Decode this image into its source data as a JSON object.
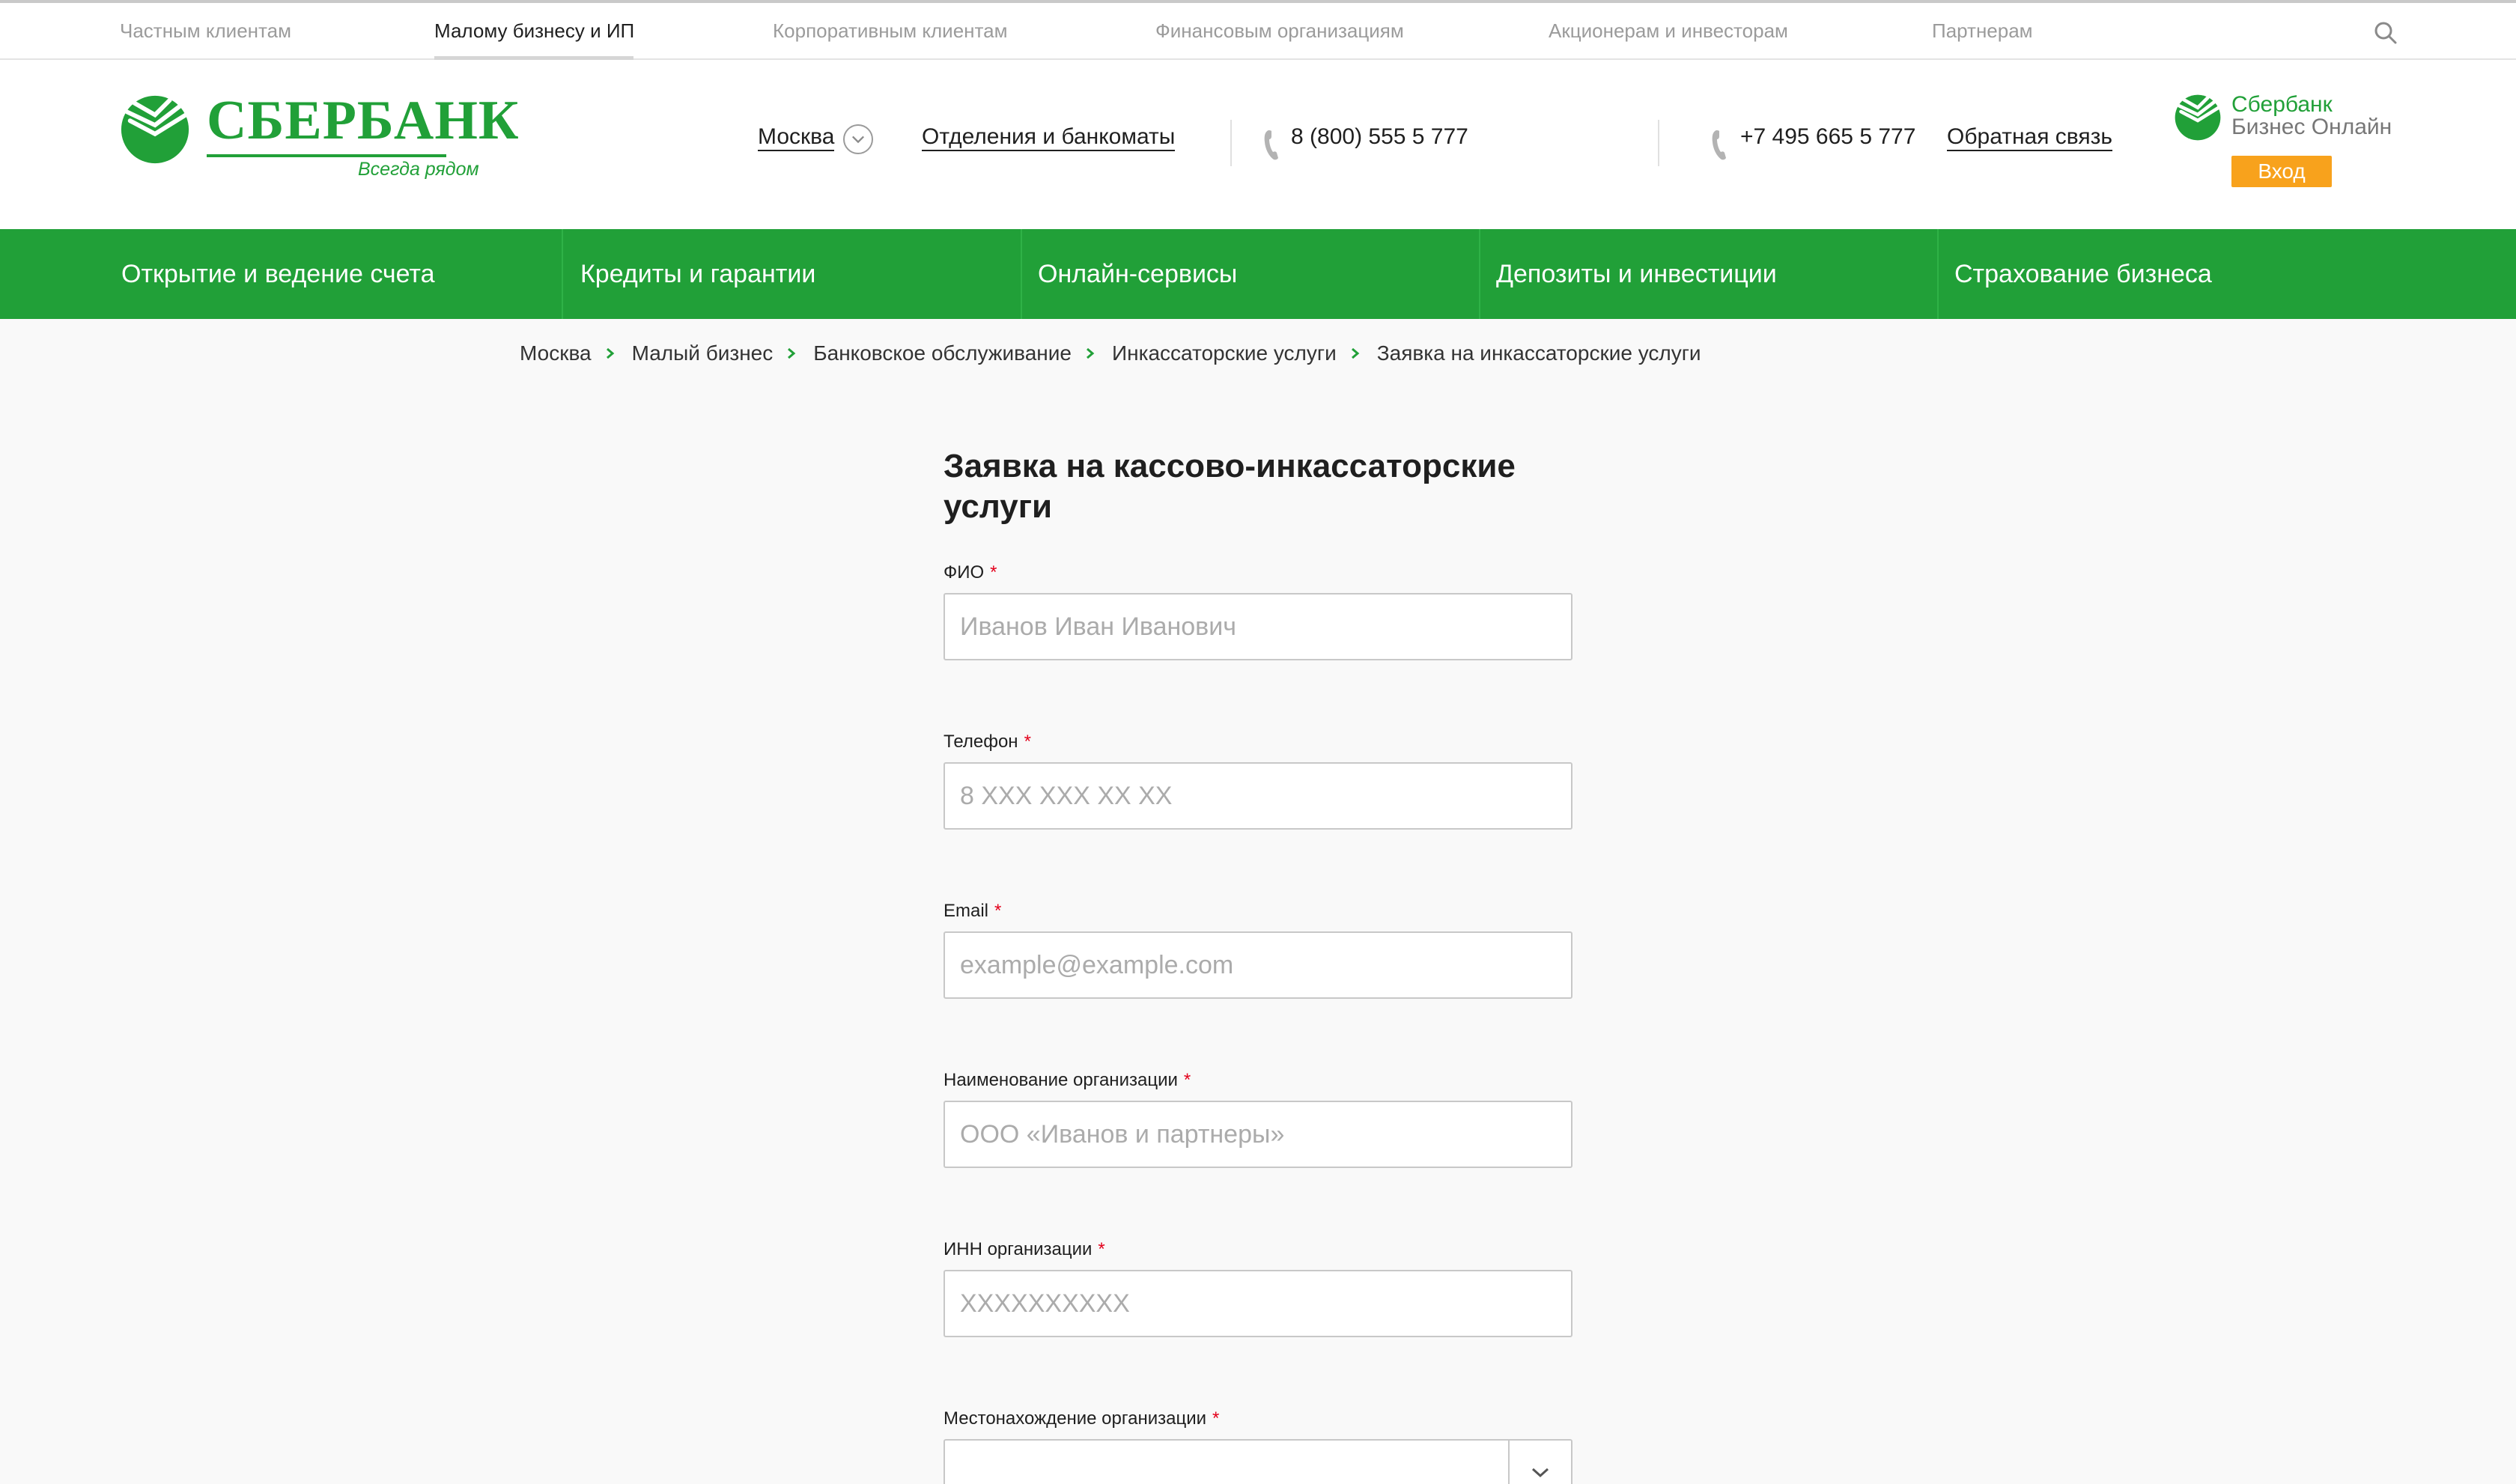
{
  "segments": [
    {
      "label": "Частным клиентам",
      "active": false
    },
    {
      "label": "Малому бизнесу и ИП",
      "active": true
    },
    {
      "label": "Корпоративным клиентам",
      "active": false
    },
    {
      "label": "Финансовым организациям",
      "active": false
    },
    {
      "label": "Акционерам и инвесторам",
      "active": false
    },
    {
      "label": "Партнерам",
      "active": false
    }
  ],
  "header": {
    "logo_text": "СБЕРБАНК",
    "logo_slogan": "Всегда рядом",
    "city": "Москва",
    "branches_link": "Отделения и банкоматы",
    "phone_1": "8 (800) 555 5 777",
    "phone_2": "+7 495 665 5 777",
    "feedback_link": "Обратная связь",
    "sbol_name_1": "Сбербанк",
    "sbol_name_2": "Бизнес Онлайн",
    "login_button": "Вход"
  },
  "nav": [
    "Открытие и ведение счета",
    "Кредиты и гарантии",
    "Онлайн-сервисы",
    "Депозиты и инвестиции",
    "Страхование бизнеса"
  ],
  "breadcrumb": [
    "Москва",
    "Малый бизнес",
    "Банковское обслуживание",
    "Инкассаторские услуги",
    "Заявка на инкассаторские услуги"
  ],
  "form": {
    "title": "Заявка на кассово-инкассаторские услуги",
    "required_mark": "*",
    "fields": [
      {
        "label": "ФИО",
        "placeholder": "Иванов Иван Иванович",
        "value": ""
      },
      {
        "label": "Телефон",
        "placeholder": "8 XXX XXX XX XX",
        "value": ""
      },
      {
        "label": "Email",
        "placeholder": "example@example.com",
        "value": ""
      },
      {
        "label": "Наименование организации",
        "placeholder": "ООО «Иванов и партнеры»",
        "value": ""
      },
      {
        "label": "ИНН организации",
        "placeholder": "XXXXXXXXXX",
        "value": ""
      },
      {
        "label": "Местонахождение организации",
        "placeholder": "",
        "value": ""
      }
    ]
  },
  "colors": {
    "brand_green": "#21a038",
    "login_orange": "#f8a21c",
    "required_red": "#e3001b",
    "page_background": "#f9f9f9"
  },
  "icons": {
    "search": "search-icon",
    "phone": "phone-icon",
    "city_dropdown": "chevron-down-icon",
    "breadcrumb_separator": "chevron-right-icon",
    "select_dropdown": "chevron-down-icon"
  }
}
